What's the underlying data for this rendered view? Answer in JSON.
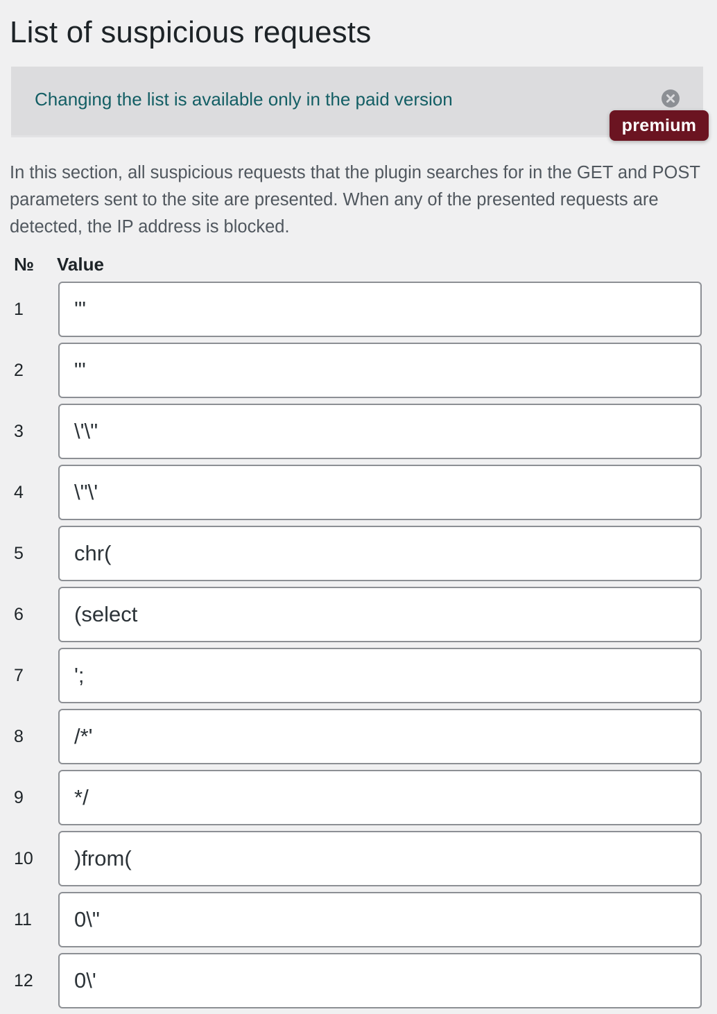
{
  "page": {
    "title": "List of suspicious requests"
  },
  "notice": {
    "message": "Changing the list is available only in the paid version",
    "dismiss_icon": "close-circle-icon",
    "badge": "premium",
    "colors": {
      "background": "#dcdcde",
      "text": "#135e64",
      "badge_background": "#6b1421",
      "badge_text": "#ffffff"
    }
  },
  "description": "In this section, all suspicious requests that the plugin searches for in the GET and POST parameters sent to the site are presented. When any of the presented requests are detected, the IP address is blocked.",
  "table": {
    "headers": {
      "number": "№",
      "value": "Value"
    },
    "rows": [
      {
        "num": "1",
        "value": "'\""
      },
      {
        "num": "2",
        "value": "\"'"
      },
      {
        "num": "3",
        "value": "\\'\\\""
      },
      {
        "num": "4",
        "value": "\\\"\\'"
      },
      {
        "num": "5",
        "value": "chr("
      },
      {
        "num": "6",
        "value": "(select"
      },
      {
        "num": "7",
        "value": "';"
      },
      {
        "num": "8",
        "value": "/*'"
      },
      {
        "num": "9",
        "value": "*/"
      },
      {
        "num": "10",
        "value": ")from("
      },
      {
        "num": "11",
        "value": "0\\\""
      },
      {
        "num": "12",
        "value": "0\\'"
      }
    ]
  }
}
